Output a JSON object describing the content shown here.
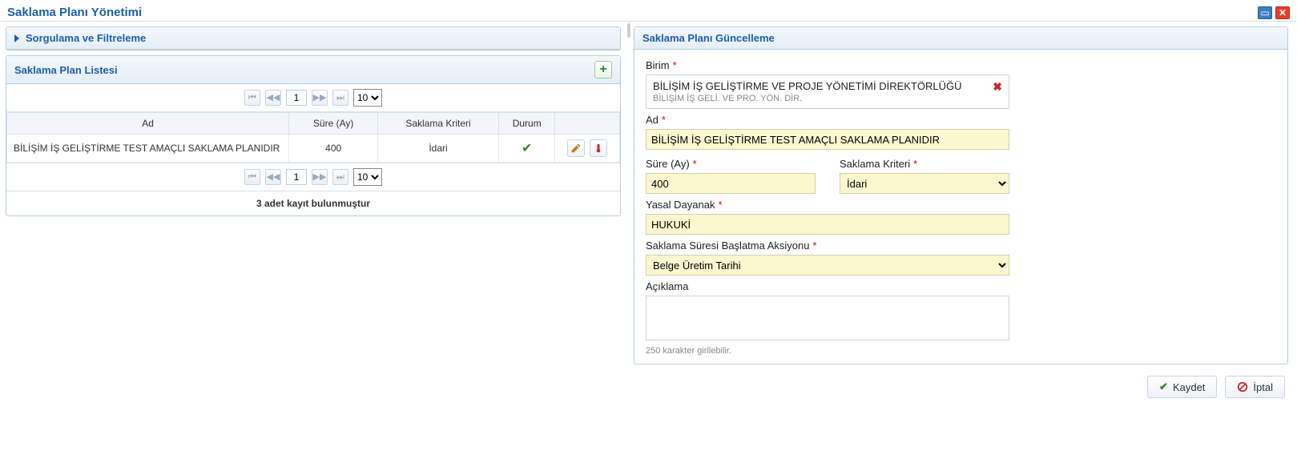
{
  "title": "Saklama Planı Yönetimi",
  "left": {
    "filter_panel_title": "Sorgulama ve Filtreleme",
    "list_panel_title": "Saklama Plan Listesi",
    "columns": {
      "ad": "Ad",
      "sure": "Süre (Ay)",
      "kriter": "Saklama Kriteri",
      "durum": "Durum"
    },
    "row": {
      "ad": "BİLİŞİM İŞ GELİŞTİRME TEST AMAÇLI SAKLAMA PLANIDIR",
      "sure": "400",
      "kriter": "İdari"
    },
    "paginator": {
      "page": "1",
      "page_size": "10"
    },
    "record_count": "3 adet kayıt bulunmuştur"
  },
  "right": {
    "panel_title": "Saklama Planı Güncelleme",
    "labels": {
      "birim": "Birim",
      "ad": "Ad",
      "sure": "Süre (Ay)",
      "kriter": "Saklama Kriteri",
      "yasal": "Yasal Dayanak",
      "aksiyon": "Saklama Süresi Başlatma Aksiyonu",
      "aciklama": "Açıklama"
    },
    "birim": {
      "value": "BİLİŞİM İŞ GELİŞTİRME VE PROJE YÖNETİMİ DİREKTÖRLÜĞÜ",
      "sub": "BİLİŞİM İŞ GELİ. VE PRO. YÖN. DİR."
    },
    "values": {
      "ad": "BİLİŞİM İŞ GELİŞTİRME TEST AMAÇLI SAKLAMA PLANIDIR",
      "sure": "400",
      "kriter": "İdari",
      "yasal": "HUKUKİ",
      "aksiyon": "Belge Üretim Tarihi",
      "aciklama": ""
    },
    "hint": "250 karakter girilebilir.",
    "buttons": {
      "save": "Kaydet",
      "cancel": "İptal"
    }
  }
}
